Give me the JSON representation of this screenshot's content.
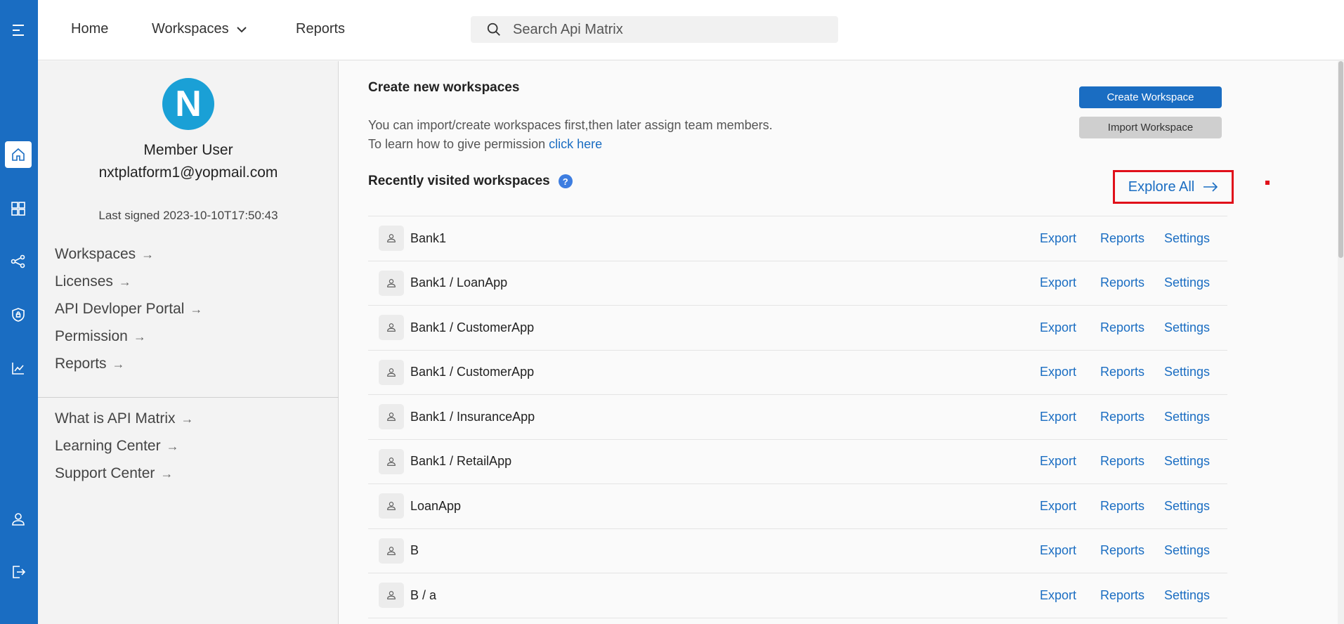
{
  "topnav": {
    "home": "Home",
    "workspaces": "Workspaces",
    "reports": "Reports",
    "search_placeholder": "Search Api Matrix"
  },
  "profile": {
    "avatar_letter": "N",
    "name": "Member User",
    "email": "nxtplatform1@yopmail.com",
    "last_signed": "Last signed 2023-10-10T17:50:43"
  },
  "side_links": [
    {
      "label": "Workspaces"
    },
    {
      "label": "Licenses"
    },
    {
      "label": "API Devloper Portal"
    },
    {
      "label": "Permission"
    },
    {
      "label": "Reports"
    }
  ],
  "help_links": [
    {
      "label": "What is API Matrix"
    },
    {
      "label": "Learning Center"
    },
    {
      "label": "Support Center"
    }
  ],
  "create": {
    "heading": "Create new workspaces",
    "desc1": "You can import/create workspaces first,then later assign team members.",
    "desc2_prefix": "To learn how to give permission ",
    "desc2_link": "click here",
    "create_button": "Create Workspace",
    "import_button": "Import Workspace"
  },
  "recent": {
    "heading": "Recently visited workspaces",
    "help_glyph": "?",
    "explore_all": "Explore All",
    "actions": {
      "export": "Export",
      "reports": "Reports",
      "settings": "Settings"
    },
    "rows": [
      {
        "name": "Bank1"
      },
      {
        "name": "Bank1 / LoanApp"
      },
      {
        "name": "Bank1 / CustomerApp"
      },
      {
        "name": "Bank1 / CustomerApp"
      },
      {
        "name": "Bank1 / InsuranceApp"
      },
      {
        "name": "Bank1 / RetailApp"
      },
      {
        "name": " LoanApp"
      },
      {
        "name": " B"
      },
      {
        "name": " B / a"
      }
    ]
  },
  "colors": {
    "primary": "#1a6dc2",
    "highlight": "#e0101a"
  }
}
